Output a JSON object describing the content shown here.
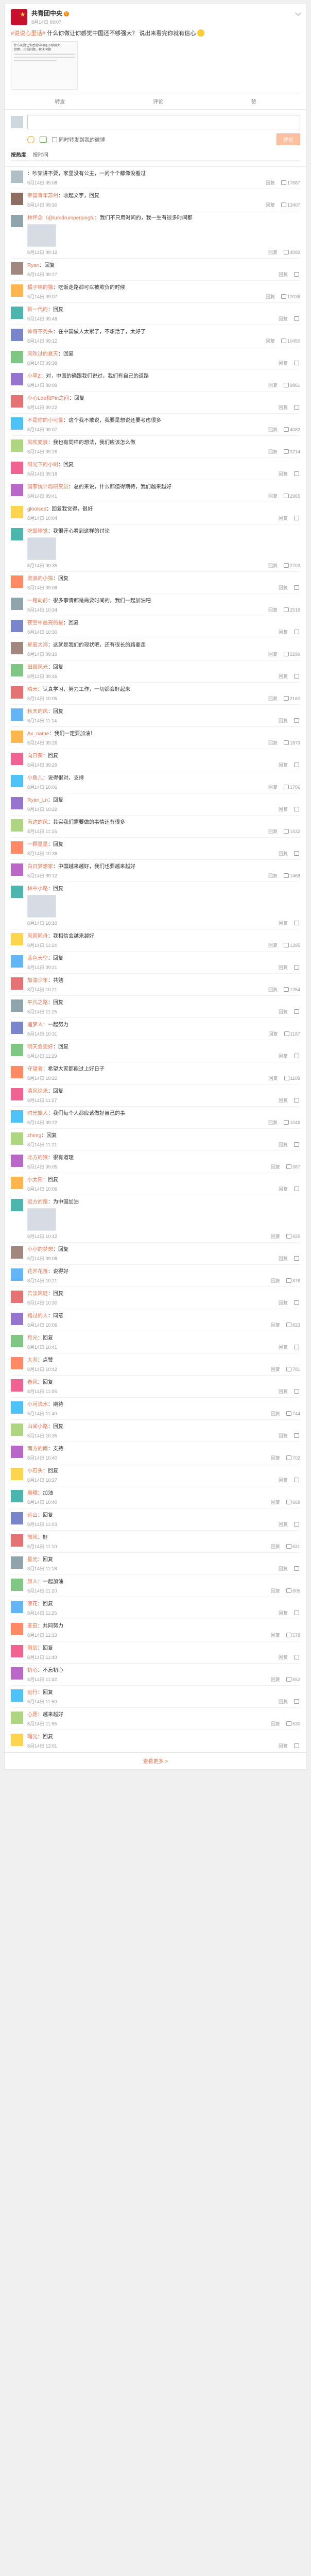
{
  "post": {
    "author": "共青团中央",
    "time": "8月14日 09:07",
    "source": "",
    "hashtag": "#说说心里话#",
    "text": "什么你做让你感觉中国还不够强大？ 说出来看完你就有信心",
    "embed_title": "什么问题让你感觉中国还不够强大",
    "embed_sub": "觉察、正视问题，解决问题",
    "actions": {
      "forward": "转发",
      "comment": "评论",
      "like": "赞"
    }
  },
  "composer": {
    "placeholder": "",
    "forward_label": "同时转发到我的微博",
    "send_label": "评论",
    "tabs": [
      "按热度",
      "按时间"
    ]
  },
  "comments": [
    {
      "name": "",
      "text": "吵架讲不要，家里没有公主，一问个个都像没看过",
      "time": "8月14日 09:08",
      "likes": "17687",
      "color": "#b0bec5"
    },
    {
      "name": "帝国青年苏州",
      "text": "收起文字，回复",
      "time": "8月14日 09:30",
      "likes": "13407",
      "color": "#8d6e63"
    },
    {
      "name": "林怀念（@lumdrumperpingfu",
      "text": "我们不只用时间的，我一生有很多时间都",
      "time": "8月14日 09:12",
      "likes": "4082",
      "color": "#90a4ae",
      "img": true
    },
    {
      "name": "Ryan",
      "text": "回复",
      "time": "8月14日 09:27",
      "likes": "",
      "color": "#a1887f"
    },
    {
      "name": "橘子味的猫",
      "text": "吃饭走路都可以被欺负的时候",
      "time": "8月14日 09:07",
      "likes": "12036",
      "color": "#ffb74d"
    },
    {
      "name": "新一代的",
      "text": "回复",
      "time": "8月14日 09:48",
      "likes": "",
      "color": "#4db6ac"
    },
    {
      "name": "帅哥不秃头",
      "text": "在中国做人太累了，不想活了，太好了",
      "time": "8月14日 09:12",
      "likes": "10450",
      "color": "#7986cb"
    },
    {
      "name": "风吹过的夏天",
      "text": "回复",
      "time": "8月14日 09:38",
      "likes": "",
      "color": "#81c784"
    },
    {
      "name": "小草Z",
      "text": "对，中国的确跟我们说过，我们有自己的道路",
      "time": "8月14日 09:09",
      "likes": "9861",
      "color": "#9575cd"
    },
    {
      "name": "小心Lee和Pin之间",
      "text": "回复",
      "time": "8月14日 09:22",
      "likes": "",
      "color": "#e57373"
    },
    {
      "name": "不是你的小可爱",
      "text": "这个我不敢说，我要是想说还要考虑很多",
      "time": "8月14日 09:07",
      "likes": "4082",
      "color": "#4fc3f7"
    },
    {
      "name": "风吹麦浪",
      "text": "我也有同样的想法，我们应该怎么做",
      "time": "8月14日 09:26",
      "likes": "3214",
      "color": "#aed581"
    },
    {
      "name": "阳光下的小树",
      "text": "回复",
      "time": "8月14日 09:18",
      "likes": "",
      "color": "#f06292"
    },
    {
      "name": "国家统计局研究员",
      "text": "总的来说，什么都值得期待，我们越来越好",
      "time": "8月14日 09:41",
      "likes": "2965",
      "color": "#ba68c8"
    },
    {
      "name": "gloolsed",
      "text": "回复我觉得，很好",
      "time": "8月14日 10:04",
      "likes": "",
      "color": "#ffd54f"
    },
    {
      "name": "吃饭睡觉",
      "text": "我很开心看到这样的讨论",
      "time": "8月14日 09:35",
      "likes": "2703",
      "color": "#4db6ac",
      "img": true
    },
    {
      "name": "流浪的小猫",
      "text": "回复",
      "time": "8月14日 09:08",
      "likes": "",
      "color": "#ff8a65"
    },
    {
      "name": "一路向前",
      "text": "很多事情都是需要时间的，我们一起加油吧",
      "time": "8月14日 10:34",
      "likes": "2518",
      "color": "#90a4ae"
    },
    {
      "name": "夜空中最亮的星",
      "text": "回复",
      "time": "8月14日 10:30",
      "likes": "",
      "color": "#7986cb"
    },
    {
      "name": "星辰大海",
      "text": "这就是我们的现状吧，还有很长的路要走",
      "time": "8月14日 09:10",
      "likes": "2299",
      "color": "#a1887f"
    },
    {
      "name": "田园风光",
      "text": "回复",
      "time": "8月14日 09:46",
      "likes": "",
      "color": "#81c784"
    },
    {
      "name": "晴天",
      "text": "认真学习，努力工作，一切都会好起来",
      "time": "8月14日 10:05",
      "likes": "2160",
      "color": "#e57373"
    },
    {
      "name": "秋天的风",
      "text": "回复",
      "time": "8月14日 11:14",
      "likes": "",
      "color": "#64b5f6"
    },
    {
      "name": "Ax_name",
      "text": "我们一定要加油！",
      "time": "8月14日 09:26",
      "likes": "1879",
      "color": "#ffb74d"
    },
    {
      "name": "向日葵",
      "text": "回复",
      "time": "8月14日 09:29",
      "likes": "",
      "color": "#f06292"
    },
    {
      "name": "小鱼儿",
      "text": "说得很对，支持",
      "time": "8月14日 10:06",
      "likes": "1706",
      "color": "#4fc3f7"
    },
    {
      "name": "Ryan_Ln",
      "text": "回复",
      "time": "8月14日 10:22",
      "likes": "",
      "color": "#9575cd"
    },
    {
      "name": "海边的风",
      "text": "其实我们需要做的事情还有很多",
      "time": "8月14日 11:15",
      "likes": "1532",
      "color": "#aed581"
    },
    {
      "name": "一颗星星",
      "text": "回复",
      "time": "8月14日 10:38",
      "likes": "",
      "color": "#ff8a65"
    },
    {
      "name": "白日梦想家",
      "text": "中国越来越好，我们也要越来越好",
      "time": "8月14日 09:12",
      "likes": "1468",
      "color": "#ba68c8"
    },
    {
      "name": "林中小路",
      "text": "回复",
      "time": "8月14日 10:10",
      "likes": "",
      "color": "#4db6ac",
      "img": true
    },
    {
      "name": "风雨同舟",
      "text": "我相信会越来越好",
      "time": "8月14日 11:14",
      "likes": "1395",
      "color": "#ffd54f"
    },
    {
      "name": "蓝色天空",
      "text": "回复",
      "time": "8月14日 09:21",
      "likes": "",
      "color": "#64b5f6"
    },
    {
      "name": "加油少年",
      "text": "共勉",
      "time": "8月14日 10:21",
      "likes": "1254",
      "color": "#e57373"
    },
    {
      "name": "平凡之路",
      "text": "回复",
      "time": "8月14日 11:15",
      "likes": "",
      "color": "#90a4ae"
    },
    {
      "name": "追梦人",
      "text": "一起努力",
      "time": "8月14日 10:31",
      "likes": "1187",
      "color": "#7986cb"
    },
    {
      "name": "明天会更好",
      "text": "回复",
      "time": "8月14日 11:29",
      "likes": "",
      "color": "#81c784"
    },
    {
      "name": "守望者",
      "text": "希望大家都能过上好日子",
      "time": "8月14日 10:22",
      "likes": "1109",
      "color": "#ff8a65"
    },
    {
      "name": "清风徐来",
      "text": "回复",
      "time": "8月14日 11:27",
      "likes": "",
      "color": "#f06292"
    },
    {
      "name": "时光旅人",
      "text": "我们每个人都应该做好自己的事",
      "time": "8月14日 09:22",
      "likes": "1046",
      "color": "#4fc3f7"
    },
    {
      "name": "zheng",
      "text": "回复",
      "time": "8月14日 11:21",
      "likes": "",
      "color": "#aed581"
    },
    {
      "name": "北方的狼",
      "text": "很有道理",
      "time": "8月14日 09:05",
      "likes": "987",
      "color": "#ba68c8"
    },
    {
      "name": "小太阳",
      "text": "回复",
      "time": "8月14日 10:06",
      "likes": "",
      "color": "#ffb74d"
    },
    {
      "name": "远方的路",
      "text": "为中国加油",
      "time": "8月14日 10:42",
      "likes": "925",
      "color": "#4db6ac",
      "img": true
    },
    {
      "name": "小小的梦想",
      "text": "回复",
      "time": "8月14日 09:08",
      "likes": "",
      "color": "#a1887f"
    },
    {
      "name": "花开花落",
      "text": "说得好",
      "time": "8月14日 10:21",
      "likes": "876",
      "color": "#64b5f6"
    },
    {
      "name": "云淡风轻",
      "text": "回复",
      "time": "8月14日 10:30",
      "likes": "",
      "color": "#e57373"
    },
    {
      "name": "路过的人",
      "text": "同意",
      "time": "8月14日 10:06",
      "likes": "823",
      "color": "#9575cd"
    },
    {
      "name": "月光",
      "text": "回复",
      "time": "8月14日 10:41",
      "likes": "",
      "color": "#81c784"
    },
    {
      "name": "大海",
      "text": "点赞",
      "time": "8月14日 10:42",
      "likes": "781",
      "color": "#ff8a65"
    },
    {
      "name": "春风",
      "text": "回复",
      "time": "8月14日 11:05",
      "likes": "",
      "color": "#f06292"
    },
    {
      "name": "小河流水",
      "text": "期待",
      "time": "8月14日 11:40",
      "likes": "744",
      "color": "#4fc3f7"
    },
    {
      "name": "山间小路",
      "text": "回复",
      "time": "8月14日 10:35",
      "likes": "",
      "color": "#aed581"
    },
    {
      "name": "南方的雨",
      "text": "支持",
      "time": "8月14日 10:40",
      "likes": "702",
      "color": "#ba68c8"
    },
    {
      "name": "小石头",
      "text": "回复",
      "time": "8月14日 10:27",
      "likes": "",
      "color": "#ffd54f"
    },
    {
      "name": "晨曦",
      "text": "加油",
      "time": "8月14日 10:40",
      "likes": "668",
      "color": "#4db6ac"
    },
    {
      "name": "远山",
      "text": "回复",
      "time": "8月14日 11:03",
      "likes": "",
      "color": "#7986cb"
    },
    {
      "name": "微风",
      "text": "好",
      "time": "8月14日 11:10",
      "likes": "631",
      "color": "#e57373"
    },
    {
      "name": "星光",
      "text": "回复",
      "time": "8月14日 11:18",
      "likes": "",
      "color": "#90a4ae"
    },
    {
      "name": "旅人",
      "text": "一起加油",
      "time": "8月14日 11:20",
      "likes": "605",
      "color": "#81c784"
    },
    {
      "name": "浪花",
      "text": "回复",
      "time": "8月14日 11:25",
      "likes": "",
      "color": "#64b5f6"
    },
    {
      "name": "麦田",
      "text": "共同努力",
      "time": "8月14日 11:33",
      "likes": "578",
      "color": "#ff8a65"
    },
    {
      "name": "雨后",
      "text": "回复",
      "time": "8月14日 11:40",
      "likes": "",
      "color": "#f06292"
    },
    {
      "name": "初心",
      "text": "不忘初心",
      "time": "8月14日 11:42",
      "likes": "552",
      "color": "#ba68c8"
    },
    {
      "name": "远行",
      "text": "回复",
      "time": "8月14日 11:50",
      "likes": "",
      "color": "#4fc3f7"
    },
    {
      "name": "心愿",
      "text": "越来越好",
      "time": "8月14日 11:55",
      "likes": "530",
      "color": "#aed581"
    },
    {
      "name": "曙光",
      "text": "回复",
      "time": "8月14日 12:01",
      "likes": "",
      "color": "#ffd54f"
    }
  ],
  "labels": {
    "reply": "回复",
    "more_prefix": "共",
    "more_suffix": "条回复"
  },
  "footer": "查看更多 >"
}
